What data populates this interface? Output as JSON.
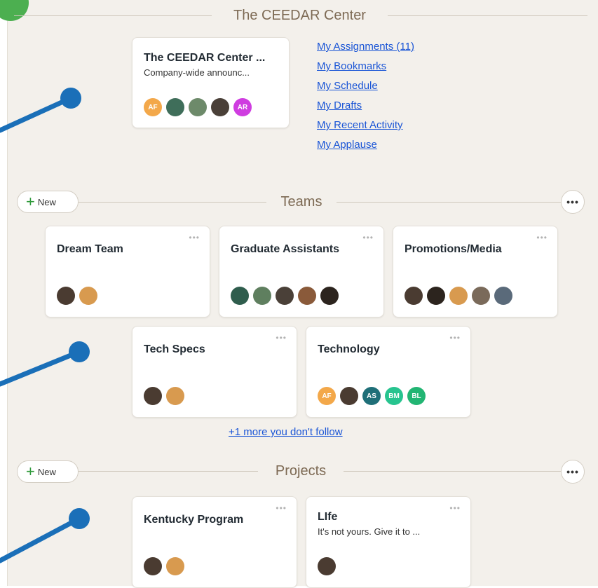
{
  "org": {
    "title": "The CEEDAR Center",
    "card": {
      "title": "The CEEDAR Center ...",
      "subtitle": "Company-wide announc...",
      "avatars": [
        {
          "initials": "AF",
          "color": "#f3a84a"
        },
        {
          "initials": "",
          "color": "#3f6e5a"
        },
        {
          "initials": "",
          "color": "#6d8a6a"
        },
        {
          "initials": "",
          "color": "#4a4038"
        },
        {
          "initials": "AR",
          "color": "#cf3de0"
        }
      ]
    },
    "links": [
      "My Assignments (11)",
      "My Bookmarks",
      "My Schedule",
      "My Drafts",
      "My Recent Activity",
      "My Applause"
    ]
  },
  "teams": {
    "title": "Teams",
    "new_label": "New",
    "more_label": "•••",
    "more_you_dont_follow": "+1 more you don't follow",
    "cards": [
      {
        "name": "Dream Team",
        "avatars": [
          {
            "initials": "",
            "color": "#4a3b31"
          },
          {
            "initials": "",
            "color": "#d89a4f"
          }
        ]
      },
      {
        "name": "Graduate Assistants",
        "avatars": [
          {
            "initials": "",
            "color": "#2f5d4d"
          },
          {
            "initials": "",
            "color": "#5f7f5f"
          },
          {
            "initials": "",
            "color": "#4a4038"
          },
          {
            "initials": "",
            "color": "#8a5a3a"
          },
          {
            "initials": "",
            "color": "#2c241e"
          }
        ]
      },
      {
        "name": "Promotions/Media",
        "avatars": [
          {
            "initials": "",
            "color": "#4a3b31"
          },
          {
            "initials": "",
            "color": "#2c241e"
          },
          {
            "initials": "",
            "color": "#d89a4f"
          },
          {
            "initials": "",
            "color": "#7a6a5a"
          },
          {
            "initials": "",
            "color": "#5a6a7a"
          }
        ]
      },
      {
        "name": "Tech Specs",
        "avatars": [
          {
            "initials": "",
            "color": "#4a3b31"
          },
          {
            "initials": "",
            "color": "#d89a4f"
          }
        ]
      },
      {
        "name": "Technology",
        "avatars": [
          {
            "initials": "AF",
            "color": "#f3a84a"
          },
          {
            "initials": "",
            "color": "#4a3b31"
          },
          {
            "initials": "AS",
            "color": "#1f6f78"
          },
          {
            "initials": "BM",
            "color": "#27c48f"
          },
          {
            "initials": "BL",
            "color": "#22b573"
          }
        ]
      }
    ]
  },
  "projects": {
    "title": "Projects",
    "new_label": "New",
    "more_label": "•••",
    "cards": [
      {
        "name": "Kentucky Program",
        "subtitle": "",
        "avatars": [
          {
            "initials": "",
            "color": "#4a3b31"
          },
          {
            "initials": "",
            "color": "#d89a4f"
          }
        ]
      },
      {
        "name": "LIfe",
        "subtitle": "It's not yours. Give it to ...",
        "avatars": [
          {
            "initials": "",
            "color": "#4a3b31"
          }
        ]
      }
    ]
  },
  "colors": {
    "accent": "#1a6fb8",
    "link": "#1a55d6",
    "plus": "#2f9a3b",
    "corner": "#4caf50"
  }
}
